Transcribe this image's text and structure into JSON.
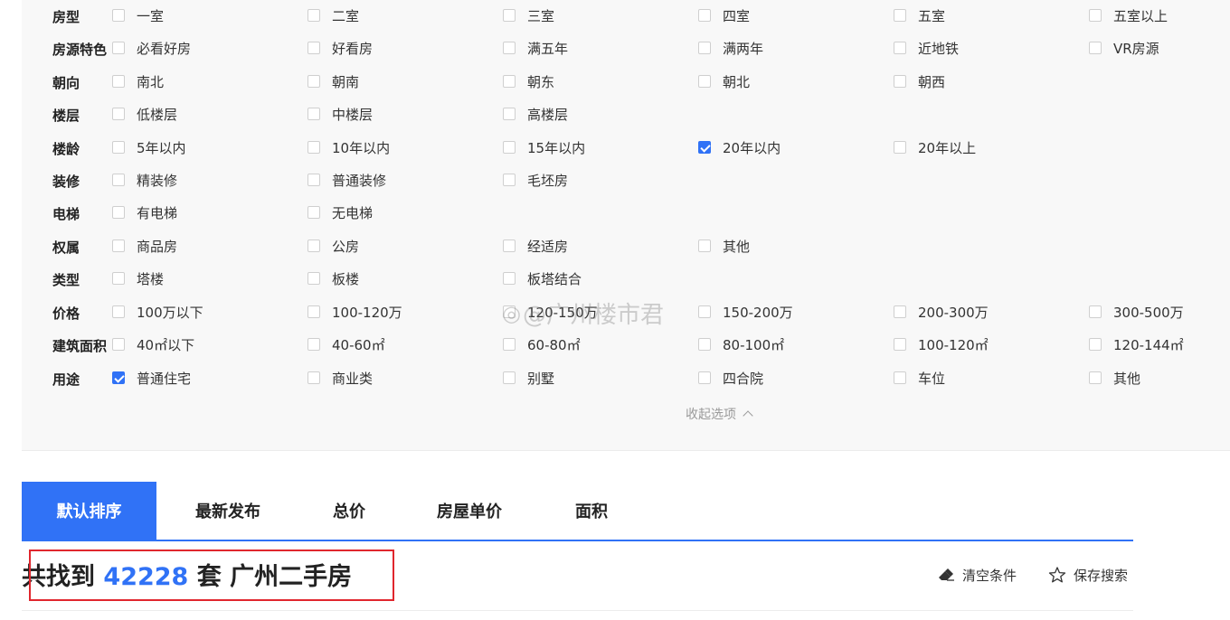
{
  "filters": {
    "rows": [
      {
        "label": "房型",
        "options": [
          {
            "text": "一室",
            "checked": false
          },
          {
            "text": "二室",
            "checked": false
          },
          {
            "text": "三室",
            "checked": false
          },
          {
            "text": "四室",
            "checked": false
          },
          {
            "text": "五室",
            "checked": false
          },
          {
            "text": "五室以上",
            "checked": false
          }
        ]
      },
      {
        "label": "房源特色",
        "options": [
          {
            "text": "必看好房",
            "checked": false
          },
          {
            "text": "好看房",
            "checked": false
          },
          {
            "text": "满五年",
            "checked": false
          },
          {
            "text": "满两年",
            "checked": false
          },
          {
            "text": "近地铁",
            "checked": false
          },
          {
            "text": "VR房源",
            "checked": false
          }
        ]
      },
      {
        "label": "朝向",
        "options": [
          {
            "text": "南北",
            "checked": false
          },
          {
            "text": "朝南",
            "checked": false
          },
          {
            "text": "朝东",
            "checked": false
          },
          {
            "text": "朝北",
            "checked": false
          },
          {
            "text": "朝西",
            "checked": false
          }
        ]
      },
      {
        "label": "楼层",
        "options": [
          {
            "text": "低楼层",
            "checked": false
          },
          {
            "text": "中楼层",
            "checked": false
          },
          {
            "text": "高楼层",
            "checked": false
          }
        ]
      },
      {
        "label": "楼龄",
        "options": [
          {
            "text": "5年以内",
            "checked": false
          },
          {
            "text": "10年以内",
            "checked": false
          },
          {
            "text": "15年以内",
            "checked": false
          },
          {
            "text": "20年以内",
            "checked": true
          },
          {
            "text": "20年以上",
            "checked": false
          }
        ]
      },
      {
        "label": "装修",
        "options": [
          {
            "text": "精装修",
            "checked": false
          },
          {
            "text": "普通装修",
            "checked": false
          },
          {
            "text": "毛坯房",
            "checked": false
          }
        ]
      },
      {
        "label": "电梯",
        "options": [
          {
            "text": "有电梯",
            "checked": false
          },
          {
            "text": "无电梯",
            "checked": false
          }
        ]
      },
      {
        "label": "权属",
        "options": [
          {
            "text": "商品房",
            "checked": false
          },
          {
            "text": "公房",
            "checked": false
          },
          {
            "text": "经适房",
            "checked": false
          },
          {
            "text": "其他",
            "checked": false
          }
        ]
      },
      {
        "label": "类型",
        "options": [
          {
            "text": "塔楼",
            "checked": false
          },
          {
            "text": "板楼",
            "checked": false
          },
          {
            "text": "板塔结合",
            "checked": false
          }
        ]
      },
      {
        "label": "价格",
        "options": [
          {
            "text": "100万以下",
            "checked": false
          },
          {
            "text": "100-120万",
            "checked": false
          },
          {
            "text": "120-150万",
            "checked": false
          },
          {
            "text": "150-200万",
            "checked": false
          },
          {
            "text": "200-300万",
            "checked": false
          },
          {
            "text": "300-500万",
            "checked": false
          }
        ]
      },
      {
        "label": "建筑面积",
        "options": [
          {
            "text": "40㎡以下",
            "checked": false
          },
          {
            "text": "40-60㎡",
            "checked": false
          },
          {
            "text": "60-80㎡",
            "checked": false
          },
          {
            "text": "80-100㎡",
            "checked": false
          },
          {
            "text": "100-120㎡",
            "checked": false
          },
          {
            "text": "120-144㎡",
            "checked": false
          }
        ]
      },
      {
        "label": "用途",
        "options": [
          {
            "text": "普通住宅",
            "checked": true
          },
          {
            "text": "商业类",
            "checked": false
          },
          {
            "text": "别墅",
            "checked": false
          },
          {
            "text": "四合院",
            "checked": false
          },
          {
            "text": "车位",
            "checked": false
          },
          {
            "text": "其他",
            "checked": false
          }
        ]
      }
    ],
    "collapse_label": "收起选项"
  },
  "sort_tabs": [
    {
      "label": "默认排序",
      "active": true
    },
    {
      "label": "最新发布",
      "active": false
    },
    {
      "label": "总价",
      "active": false
    },
    {
      "label": "房屋单价",
      "active": false
    },
    {
      "label": "面积",
      "active": false
    }
  ],
  "result": {
    "prefix": "共找到",
    "count": "42228",
    "suffix": "套 广州二手房"
  },
  "tools": {
    "clear_label": "清空条件",
    "save_label": "保存搜索"
  },
  "watermark": {
    "text": "@广州楼市君"
  },
  "colors": {
    "accent": "#3072f6",
    "highlight_box": "#e0262d"
  }
}
